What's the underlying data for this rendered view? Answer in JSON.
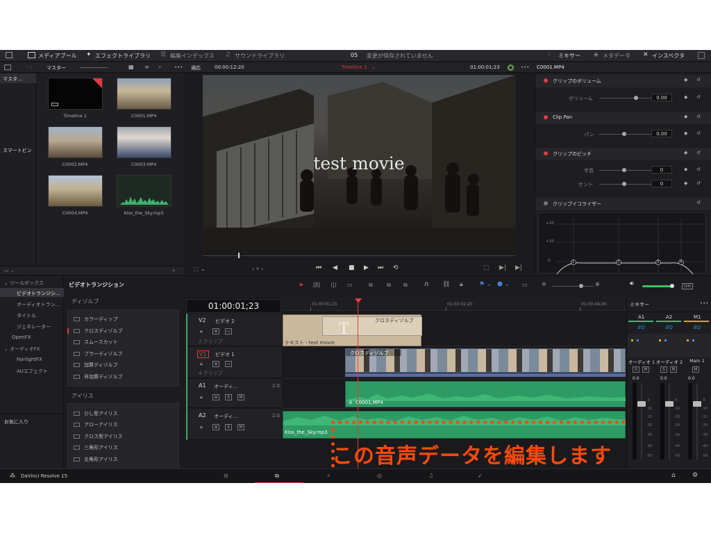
{
  "topbar": {
    "media_pool": "メディアプール",
    "effects_library": "エフェクトライブラリ",
    "edit_index": "編集インデックス",
    "sound_library": "サウンドライブラリ",
    "project_number": "05",
    "save_status": "変更が保存されていません",
    "mixer": "ミキサー",
    "metadata": "メタデータ",
    "inspector": "インスペクタ"
  },
  "subbar": {
    "master": "マスター",
    "fit": "適応",
    "source_timecode": "00:00:12:20",
    "timeline_name": "Timeline 1",
    "record_timecode": "01:00:01;23",
    "inspector_clip": "C0001.MP4"
  },
  "bins": {
    "master": "マスタ...",
    "smart_bins": "スマートビン"
  },
  "media": [
    {
      "name": "Timeline 1"
    },
    {
      "name": "C0001.MP4"
    },
    {
      "name": "C0002.MP4"
    },
    {
      "name": "C0003.MP4"
    },
    {
      "name": "C0004.MP4"
    },
    {
      "name": "Kiss_the_Sky.mp3"
    }
  ],
  "viewer": {
    "overlay_text": "test movie"
  },
  "inspector": {
    "clip_volume": {
      "title": "クリップのボリューム",
      "label": "ボリューム",
      "value": "0.00"
    },
    "clip_pan": {
      "title": "Clip Pan",
      "label": "パン",
      "value": "0.00"
    },
    "clip_pitch": {
      "title": "クリップのピッチ",
      "semitone_label": "半音",
      "semitone_value": "0",
      "cent_label": "セント",
      "cent_value": "0"
    },
    "clip_eq": {
      "title": "クリップイコライザー",
      "y_ticks": [
        "+20",
        "+10",
        "0"
      ],
      "bands": [
        "1",
        "2",
        "3",
        "4"
      ]
    }
  },
  "effects_tree": {
    "toolbox": "ツールボックス",
    "items": [
      "ビデオトランジシ...",
      "オーディオトラン...",
      "タイトル",
      "ジェネレーター"
    ],
    "openfx": "OpenFX",
    "audiofx": "オーディオFX",
    "audiofx_items": [
      "FairlightFX",
      "AUエフェクト"
    ],
    "favorites": "お気に入り"
  },
  "transitions": {
    "header": "ビデオトランジション",
    "dissolve_section": "ディゾルブ",
    "dissolves": [
      "カラーディップ",
      "クロスディゾルブ",
      "スムースカット",
      "ブラーディゾルブ",
      "加算ディゾルブ",
      "非加算ディゾルブ"
    ],
    "iris_section": "アイリス",
    "irises": [
      "ひし型アイリス",
      "アローアイリス",
      "クロス型アイリス",
      "三角形アイリス",
      "五角形アイリス"
    ]
  },
  "timeline": {
    "timecode": "01:00:01;23",
    "ruler": [
      "01:00:01;10",
      "01:00:02;20",
      "01:00:04;00"
    ],
    "tracks": {
      "v2": {
        "id": "V2",
        "name": "ビデオ 2",
        "clips": "2 クリップ"
      },
      "v1": {
        "id": "V1",
        "name": "ビデオ 1",
        "clips": "4 クリップ"
      },
      "a1": {
        "id": "A1",
        "name": "オーディ...",
        "level": "2.0"
      },
      "a2": {
        "id": "A2",
        "name": "オーディ...",
        "level": "2.0"
      }
    },
    "clips": {
      "v2_transition": "クロスディゾルブ",
      "v2_text": "テキスト - test movie",
      "v1_transition": "クロスディゾルブ",
      "a1_clip": "C0001.MP4",
      "a2_clip": "Kiss_the_Sky.mp3"
    }
  },
  "mixer": {
    "title": "ミキサー",
    "channels": [
      "A1",
      "A2",
      "M1"
    ],
    "eq": "EQ",
    "strip_names": [
      "オーディオ 1",
      "オーディオ 2",
      "Main 1"
    ],
    "values": [
      "0.0",
      "0.0",
      "0.0"
    ],
    "scale": [
      "-5",
      "-10",
      "-15",
      "-20",
      "-30",
      "-40",
      "-50"
    ]
  },
  "annotation": {
    "text": "この音声データを編集します"
  },
  "footer": {
    "app_name": "DaVinci Resolve 15"
  },
  "colors": {
    "accent_red": "#e03c3c",
    "audio_green": "#2e9a64",
    "annotation_orange": "#ff4a0a"
  }
}
